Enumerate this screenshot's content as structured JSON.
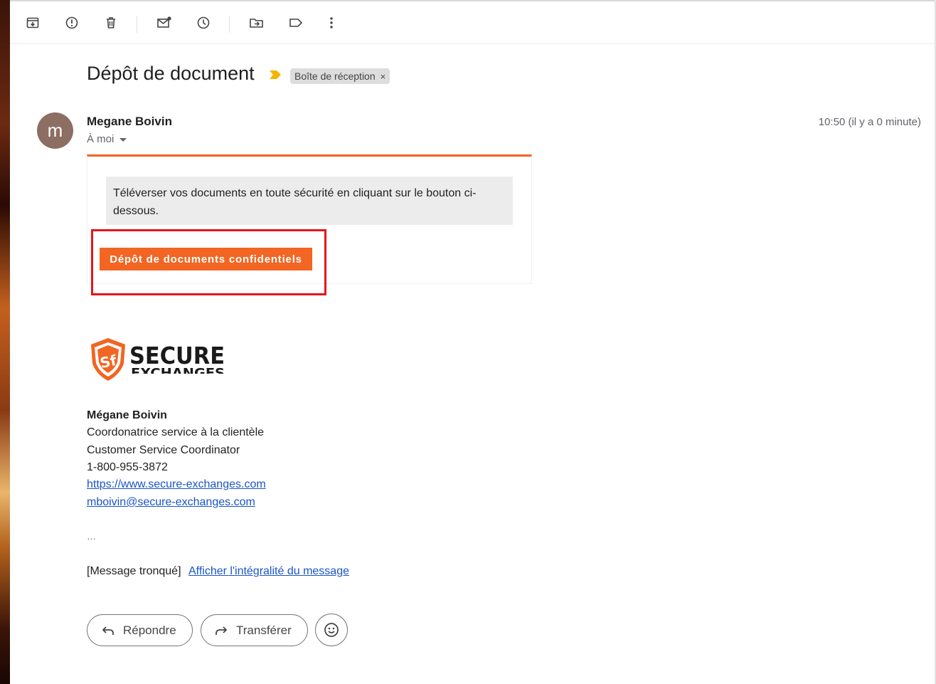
{
  "toolbar": {
    "icons": [
      "archive-icon",
      "report-spam-icon",
      "delete-icon",
      "mark-unread-icon",
      "snooze-icon",
      "move-to-icon",
      "label-icon",
      "more-options-icon"
    ]
  },
  "message": {
    "subject": "Dépôt de document",
    "label": "Boîte de réception",
    "label_close": "×",
    "sender_initial": "m",
    "sender_name": "Megane Boivin",
    "recipient": "À moi",
    "time": "10:50 (il y a 0 minute)",
    "body_text": "Téléverser vos documents en toute sécurité en cliquant sur le bouton ci-dessous.",
    "cta_button": "Dépôt de documents confidentiels"
  },
  "signature": {
    "logo_text_1": "SECURE",
    "logo_text_2": "EXCHANGES",
    "logo_badge": "Sf",
    "name": "Mégane Boivin",
    "title_fr": "Coordonatrice service à la clientèle",
    "title_en": "Customer Service Coordinator",
    "phone": "1-800-955-3872",
    "website": "https://www.secure-exchanges.com",
    "email": "mboivin@secure-exchanges.com"
  },
  "truncation": {
    "ellipsis": "…",
    "notice": "[Message tronqué]",
    "link": "Afficher l'intégralité du message"
  },
  "actions": {
    "reply": "Répondre",
    "forward": "Transférer"
  },
  "colors": {
    "accent": "#f26522",
    "highlight": "#e8141c",
    "link": "#1a55c7"
  }
}
